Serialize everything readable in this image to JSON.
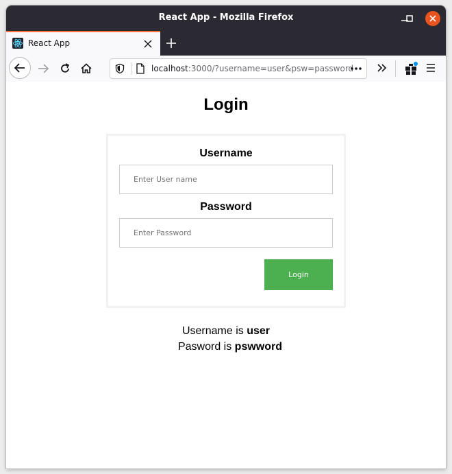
{
  "window": {
    "title": "React App - Mozilla Firefox"
  },
  "tabs": [
    {
      "label": "React App",
      "icon": "react-logo-icon"
    }
  ],
  "address_bar": {
    "host": "localhost",
    "path": ":3000/?username=user&psw=password"
  },
  "page": {
    "title": "Login",
    "form": {
      "username_label": "Username",
      "username_value": "",
      "username_placeholder": "Enter User name",
      "password_label": "Password",
      "password_value": "",
      "password_placeholder": "Enter Password",
      "submit_label": "Login"
    },
    "result": {
      "username_prefix": "Username is ",
      "username_value": "user",
      "password_prefix": "Pasword is ",
      "password_value": "pswword"
    }
  },
  "colors": {
    "titlebar": "#2b2a33",
    "tab_accent": "#ff7139",
    "close_button": "#e9541f",
    "submit_button": "#4caf50",
    "react_logo": "#61dafb"
  }
}
